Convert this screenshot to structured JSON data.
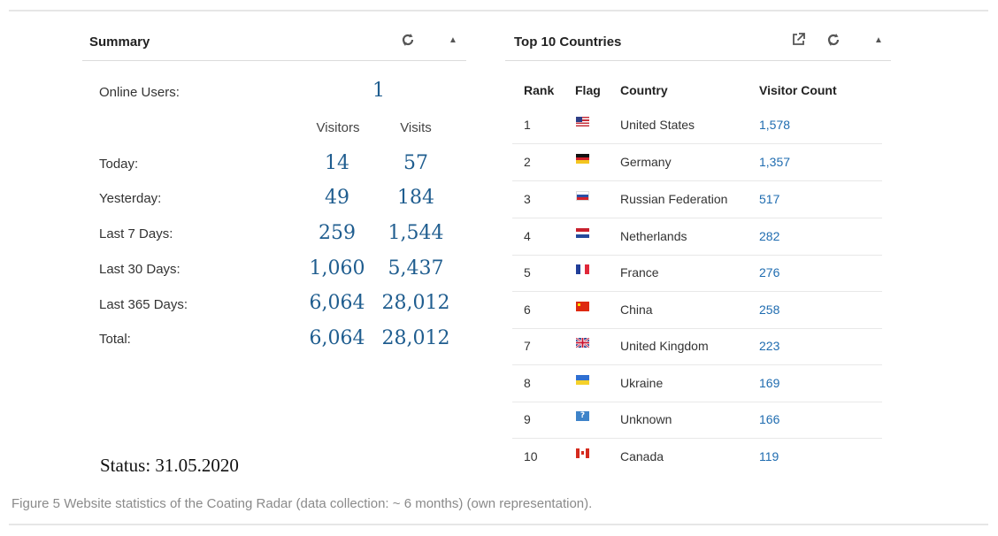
{
  "summary": {
    "title": "Summary",
    "online_label": "Online Users:",
    "online_value": "1",
    "col_visitors": "Visitors",
    "col_visits": "Visits",
    "rows": [
      {
        "label": "Today:",
        "visitors": "14",
        "visits": "57"
      },
      {
        "label": "Yesterday:",
        "visitors": "49",
        "visits": "184"
      },
      {
        "label": "Last 7 Days:",
        "visitors": "259",
        "visits": "1,544"
      },
      {
        "label": "Last 30 Days:",
        "visitors": "1,060",
        "visits": "5,437"
      },
      {
        "label": "Last 365 Days:",
        "visitors": "6,064",
        "visits": "28,012"
      },
      {
        "label": "Total:",
        "visitors": "6,064",
        "visits": "28,012"
      }
    ],
    "status": "Status: 31.05.2020",
    "icons": [
      "refresh-icon",
      "collapse-up-icon"
    ]
  },
  "countries": {
    "title": "Top 10 Countries",
    "icons": [
      "external-link-icon",
      "refresh-icon",
      "collapse-up-icon"
    ],
    "headers": {
      "rank": "Rank",
      "flag": "Flag",
      "country": "Country",
      "count": "Visitor Count"
    },
    "rows": [
      {
        "rank": "1",
        "flag": "us-flag-icon",
        "country": "United States",
        "count": "1,578"
      },
      {
        "rank": "2",
        "flag": "de-flag-icon",
        "country": "Germany",
        "count": "1,357"
      },
      {
        "rank": "3",
        "flag": "ru-flag-icon",
        "country": "Russian Federation",
        "count": "517"
      },
      {
        "rank": "4",
        "flag": "nl-flag-icon",
        "country": "Netherlands",
        "count": "282"
      },
      {
        "rank": "5",
        "flag": "fr-flag-icon",
        "country": "France",
        "count": "276"
      },
      {
        "rank": "6",
        "flag": "cn-flag-icon",
        "country": "China",
        "count": "258"
      },
      {
        "rank": "7",
        "flag": "gb-flag-icon",
        "country": "United Kingdom",
        "count": "223"
      },
      {
        "rank": "8",
        "flag": "ua-flag-icon",
        "country": "Ukraine",
        "count": "169"
      },
      {
        "rank": "9",
        "flag": "unknown-flag-icon",
        "country": "Unknown",
        "count": "166"
      },
      {
        "rank": "10",
        "flag": "ca-flag-icon",
        "country": "Canada",
        "count": "119"
      }
    ]
  },
  "caption": "Figure 5 Website statistics of the Coating Radar (data collection: ~ 6 months) (own representation).",
  "colors": {
    "value_blue": "#1f5d8f",
    "link_blue": "#1f6cb0",
    "caption_gray": "#8a8a8a"
  }
}
